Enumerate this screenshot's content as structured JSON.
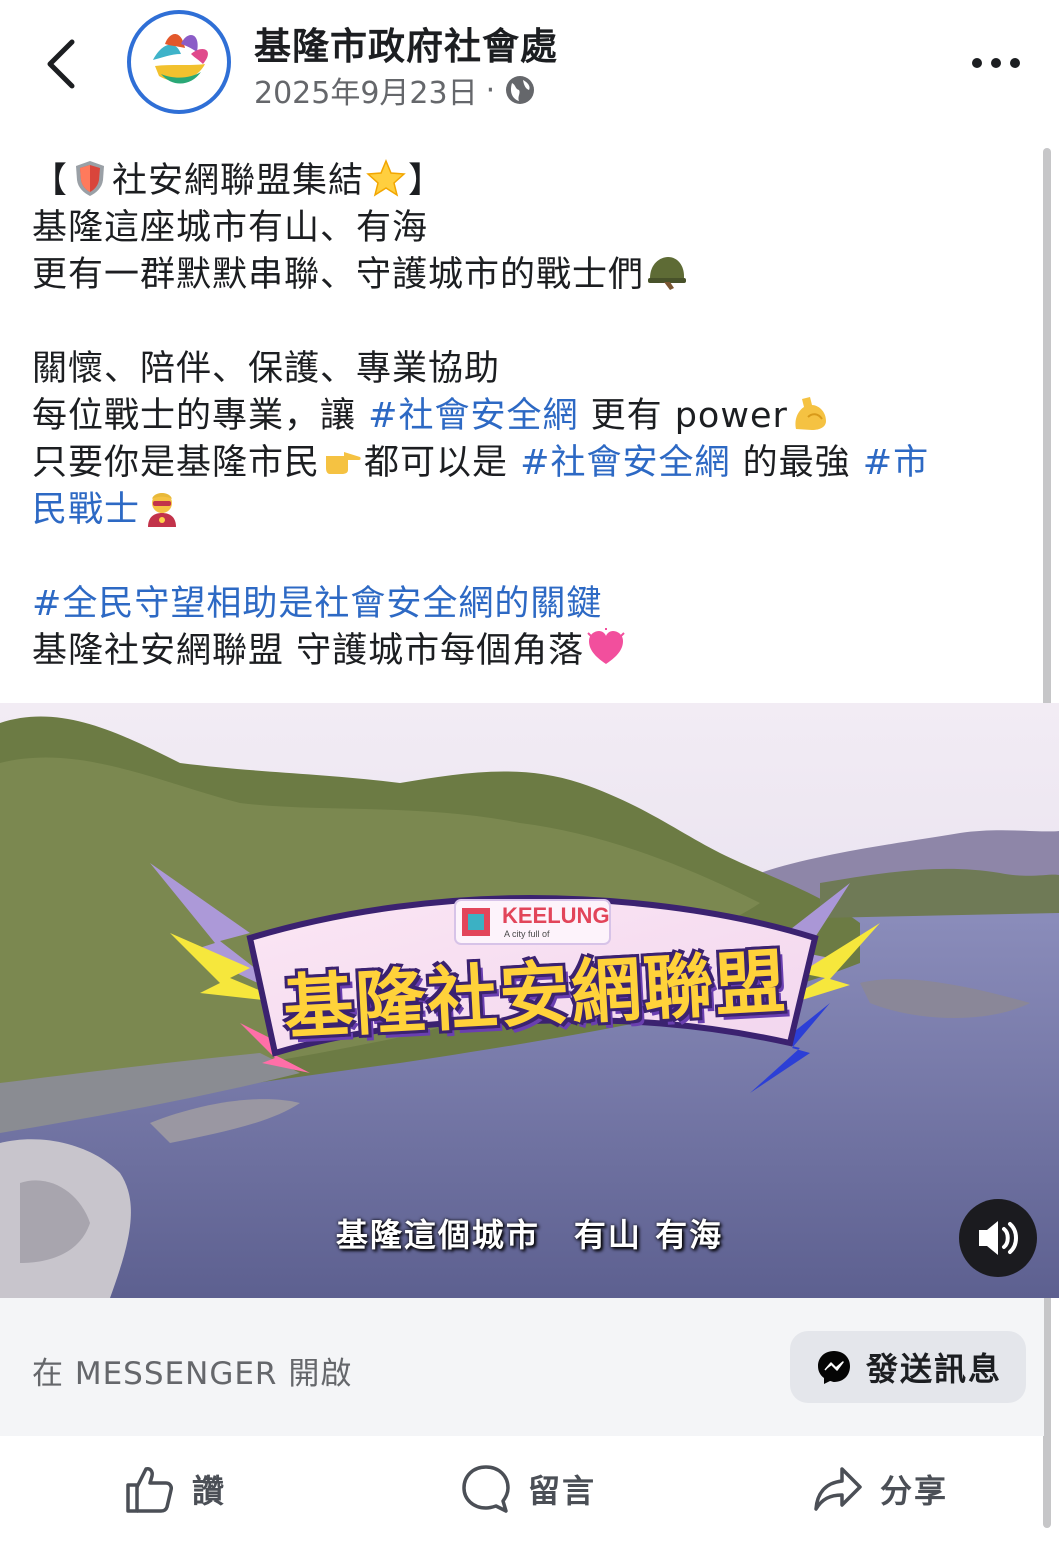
{
  "header": {
    "page_name": "基隆市政府社會處",
    "date": "2025年9月23日",
    "separator": "·",
    "icons": {
      "back": "chevron-left-icon",
      "privacy": "globe-icon",
      "more": "more-horizontal-icon"
    }
  },
  "post": {
    "line1_open": "【",
    "line1_text": "社安網聯盟集結",
    "line1_close": "】",
    "line2": "基隆這座城市有山、有海",
    "line3": "更有一群默默串聯、守護城市的戰士們",
    "line4": "關懷、陪伴、保護、專業協助",
    "line5_a": "每位戰士的專業，讓 ",
    "line5_tag": "#社會安全網",
    "line5_b": " 更有 power",
    "line6_a": "只要你是基隆市民",
    "line6_b": "都可以是 ",
    "line6_tag": "#社會安全網",
    "line6_c": " 的最強 ",
    "line6_tag2": "#市",
    "line7_tag": "民戰士",
    "line8_tag": "#全民守望相助是社會安全網的關鍵",
    "line9": "基隆社安網聯盟 守護城市每個角落",
    "emojis": [
      "shield-emoji",
      "star-emoji",
      "helmet-emoji",
      "flexed-biceps-emoji",
      "pointing-right-emoji",
      "superhero-emoji",
      "heart-emoji"
    ]
  },
  "video": {
    "logo_text": "KEELUNG",
    "logo_tagline": "A city full of",
    "title_banner": "基隆社安網聯盟",
    "subtitle": "基隆這個城市　有山 有海",
    "icons": {
      "volume": "volume-icon"
    }
  },
  "messenger": {
    "prompt": "在 MESSENGER 開啟",
    "button_label": "發送訊息",
    "icon": "messenger-icon"
  },
  "actions": [
    {
      "label": "讚",
      "icon": "like-icon"
    },
    {
      "label": "留言",
      "icon": "comment-icon"
    },
    {
      "label": "分享",
      "icon": "share-icon"
    }
  ],
  "colors": {
    "hashtag": "#2d69c4",
    "secondary_text": "#65676b",
    "avatar_ring": "#2f6fd6"
  }
}
